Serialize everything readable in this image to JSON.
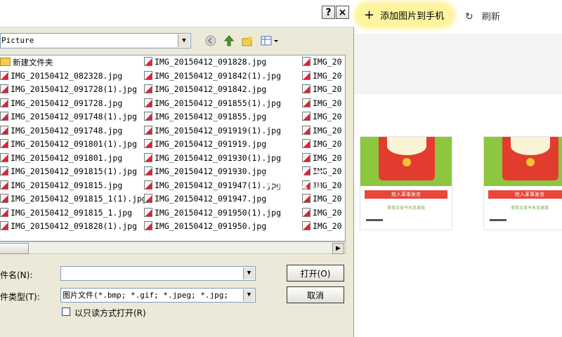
{
  "dialog": {
    "help_label": "?",
    "close_label": "×",
    "look_in_value": "Picture",
    "files": [
      [
        {
          "name": "新建文件夹",
          "folder": true
        },
        {
          "name": "IMG_20150412_082328.jpg"
        },
        {
          "name": "IMG_20150412_091728(1).jpg"
        },
        {
          "name": "IMG_20150412_091728.jpg"
        },
        {
          "name": "IMG_20150412_091748(1).jpg"
        },
        {
          "name": "IMG_20150412_091748.jpg"
        },
        {
          "name": "IMG_20150412_091801(1).jpg"
        },
        {
          "name": "IMG_20150412_091801.jpg"
        },
        {
          "name": "IMG_20150412_091815(1).jpg"
        },
        {
          "name": "IMG_20150412_091815.jpg"
        },
        {
          "name": "IMG_20150412_091815_1(1).jpg"
        },
        {
          "name": "IMG_20150412_091815_1.jpg"
        },
        {
          "name": "IMG_20150412_091828(1).jpg"
        }
      ],
      [
        {
          "name": "IMG_20150412_091828.jpg"
        },
        {
          "name": "IMG_20150412_091842(1).jpg"
        },
        {
          "name": "IMG_20150412_091842.jpg"
        },
        {
          "name": "IMG_20150412_091855(1).jpg"
        },
        {
          "name": "IMG_20150412_091855.jpg"
        },
        {
          "name": "IMG_20150412_091919(1).jpg"
        },
        {
          "name": "IMG_20150412_091919.jpg"
        },
        {
          "name": "IMG_20150412_091930(1).jpg"
        },
        {
          "name": "IMG_20150412_091930.jpg"
        },
        {
          "name": "IMG_20150412_091947(1).jpg"
        },
        {
          "name": "IMG_20150412_091947.jpg"
        },
        {
          "name": "IMG_20150412_091950(1).jpg"
        },
        {
          "name": "IMG_20150412_091950.jpg"
        }
      ],
      [
        {
          "name": "IMG_20"
        },
        {
          "name": "IMG_20"
        },
        {
          "name": "IMG_20"
        },
        {
          "name": "IMG_20"
        },
        {
          "name": "IMG_20"
        },
        {
          "name": "IMG_20"
        },
        {
          "name": "IMG_20"
        },
        {
          "name": "IMG_20"
        },
        {
          "name": "IMG_20"
        },
        {
          "name": "IMG_20"
        },
        {
          "name": "IMG_20"
        },
        {
          "name": "IMG_20"
        },
        {
          "name": "IMG_20"
        }
      ]
    ],
    "filename_label": "件名(N):",
    "filename_value": "",
    "filetype_label": "件类型(T):",
    "filetype_value": "图片文件(*.bmp; *.gif; *.jpeg; *.jpg;",
    "readonly_label": "以只读方式打开(R)",
    "open_label": "打开(O)",
    "cancel_label": "取消"
  },
  "panel": {
    "add_label": "添加图片到手机",
    "refresh_label": "刷新",
    "thumbnails": [
      {
        "button": "抢入革事发言",
        "link": "非常点击今天见发现"
      },
      {
        "button": "抢入革事发言",
        "link": "非常点击今天见发现"
      }
    ],
    "watermark": "好又手"
  },
  "colors": {
    "accent_yellow": "#fff5a0",
    "red": "#e23c2e",
    "green": "#8dc63f",
    "dialog_bg": "#ece9d8"
  }
}
